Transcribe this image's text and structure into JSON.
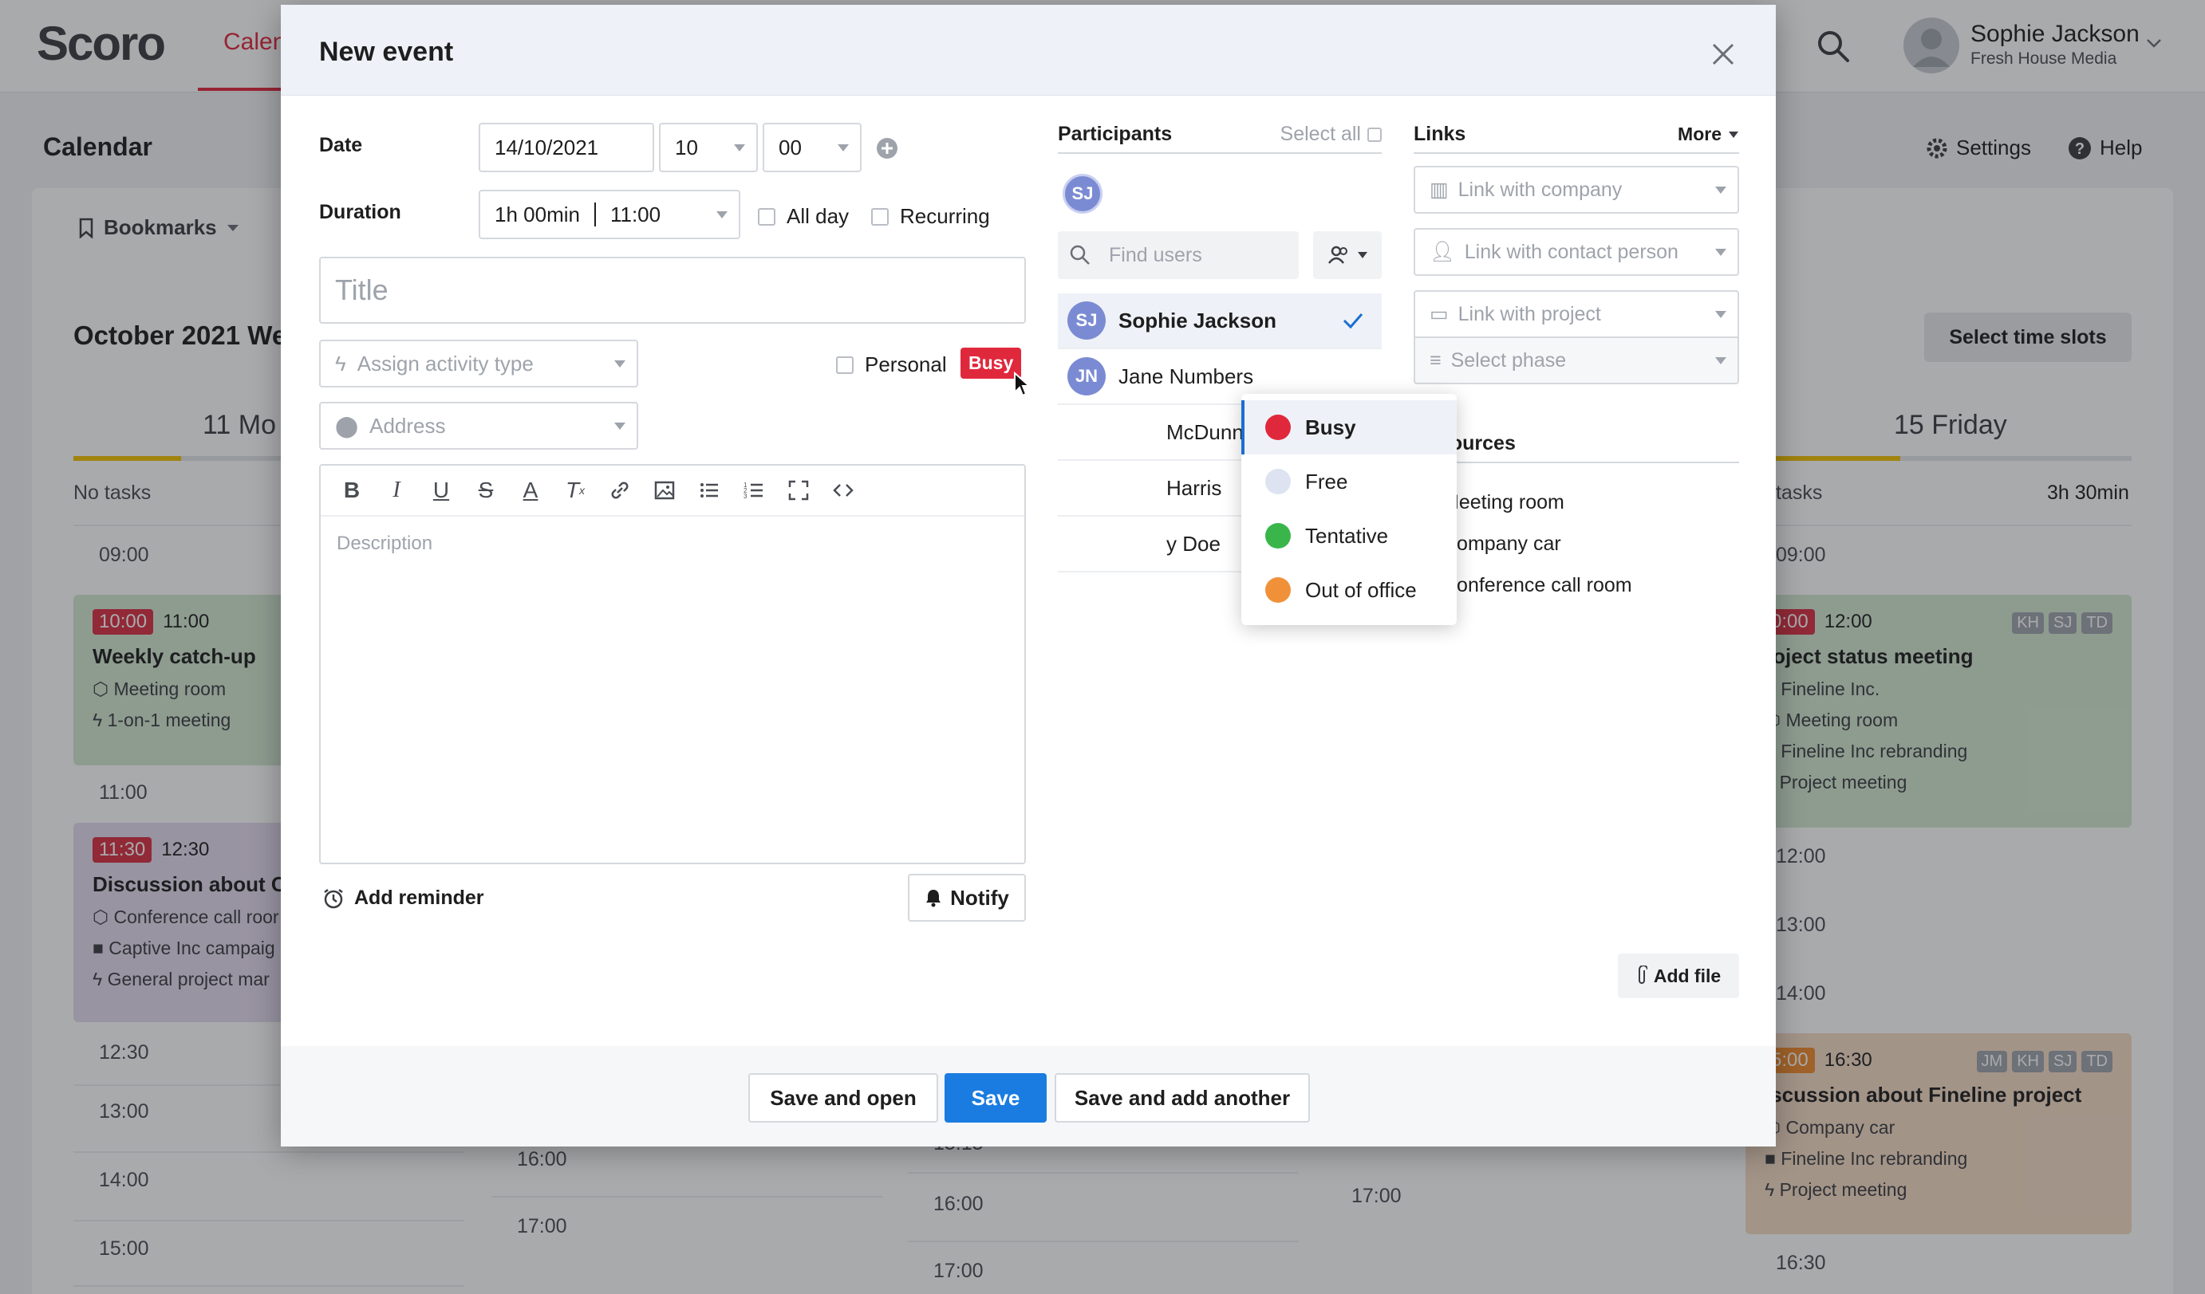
{
  "app": {
    "logo": "Scoro",
    "nav_active": "Calen",
    "user": {
      "name": "Sophie Jackson",
      "org": "Fresh House Media"
    },
    "page_title": "Calendar",
    "settings_label": "Settings",
    "help_label": "Help",
    "bookmarks_label": "Bookmarks",
    "calendar_header": "October 2021 We",
    "select_time_slots": "Select time slots",
    "days": [
      {
        "num": "11",
        "name": "Mo",
        "tasks": "No tasks",
        "progress": 0.45
      },
      {
        "num": "15",
        "name": "Friday",
        "tasks": "tasks",
        "duration": "3h 30min",
        "progress": 0.35
      }
    ],
    "left_column": {
      "times": [
        "09:00",
        "11:00",
        "12:30",
        "13:00",
        "14:00",
        "15:00"
      ],
      "events": [
        {
          "start": "10:00",
          "end": "11:00",
          "title": "Weekly catch-up",
          "lines": [
            "Meeting room",
            "1-on-1 meeting"
          ]
        },
        {
          "start": "11:30",
          "end": "12:30",
          "title": "Discussion about Ca",
          "lines": [
            "Conference call roor",
            "Captive Inc campaig",
            "General project mar"
          ]
        }
      ]
    },
    "mid_times": {
      "col2": [
        "16:00",
        "17:00"
      ],
      "col3": [
        "15:15",
        "16:00",
        "17:00"
      ],
      "col4": [
        "17:00"
      ]
    },
    "right_column": {
      "times": [
        "09:00",
        "12:00",
        "13:00",
        "14:00",
        "16:30"
      ],
      "events": [
        {
          "start": "0:00",
          "end": "12:00",
          "title": "roject status meeting",
          "lines": [
            "Fineline Inc.",
            "Meeting room",
            "Fineline Inc rebranding",
            "Project meeting"
          ],
          "initials": [
            "KH",
            "SJ",
            "TD"
          ]
        },
        {
          "start": "5:00",
          "end": "16:30",
          "title": "iscussion about Fineline project",
          "lines": [
            "Company car",
            "Fineline Inc rebranding",
            "Project meeting"
          ],
          "initials": [
            "JM",
            "KH",
            "SJ",
            "TD"
          ]
        }
      ]
    }
  },
  "modal": {
    "title": "New event",
    "date_label": "Date",
    "date_value": "14/10/2021",
    "hour_value": "10",
    "minute_value": "00",
    "duration_label": "Duration",
    "duration_value": "1h 00min",
    "end_time": "11:00",
    "all_day_label": "All day",
    "recurring_label": "Recurring",
    "title_placeholder": "Title",
    "activity_placeholder": "Assign activity type",
    "personal_label": "Personal",
    "status_badge": "Busy",
    "address_placeholder": "Address",
    "description_placeholder": "Description",
    "add_reminder": "Add reminder",
    "notify": "Notify",
    "participants": {
      "header": "Participants",
      "select_all": "Select all",
      "selected_avatar": "SJ",
      "find_placeholder": "Find users",
      "list": [
        {
          "initials": "SJ",
          "name": "Sophie Jackson",
          "selected": true
        },
        {
          "initials": "JN",
          "name": "Jane Numbers"
        },
        {
          "initials": "",
          "name": "McDunn"
        },
        {
          "initials": "",
          "name": "Harris"
        },
        {
          "initials": "",
          "name": "y Doe"
        }
      ]
    },
    "links": {
      "header": "Links",
      "more": "More",
      "company": "Link with company",
      "contact": "Link with contact person",
      "project": "Link with project",
      "phase": "Select phase"
    },
    "resources": {
      "header": "Resources",
      "items": [
        "Meeting room",
        "Company car",
        "Conference call room"
      ]
    },
    "add_file": "Add file",
    "buttons": {
      "save_open": "Save and open",
      "save": "Save",
      "save_another": "Save and add another"
    },
    "status_menu": [
      {
        "label": "Busy",
        "color": "#e0283d",
        "active": true
      },
      {
        "label": "Free",
        "color": "#dde3f0"
      },
      {
        "label": "Tentative",
        "color": "#3ab54a"
      },
      {
        "label": "Out of office",
        "color": "#f0913a"
      }
    ]
  }
}
